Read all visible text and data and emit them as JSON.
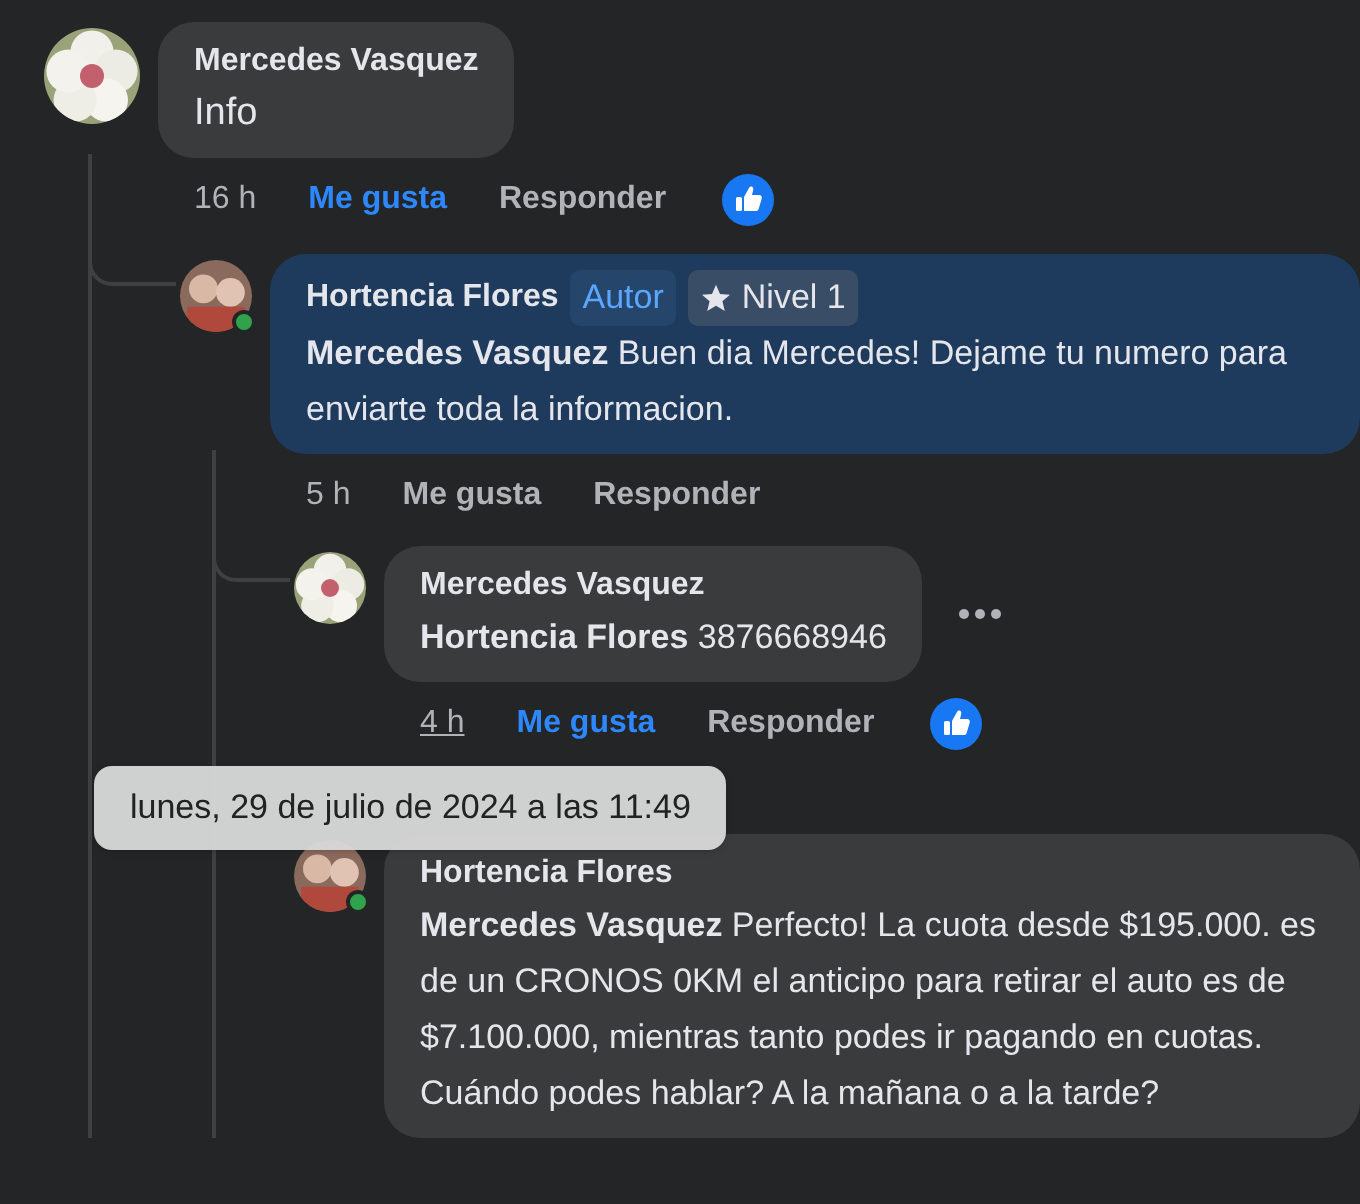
{
  "comments": [
    {
      "author": "Mercedes Vasquez",
      "text": "Info",
      "time": "16 h",
      "like_label": "Me gusta",
      "liked": true,
      "reply_label": "Responder",
      "reaction": true,
      "children": [
        {
          "author": "Hortencia Flores",
          "text": "**Mercedes Vasquez** Buen dia Mercedes! Dejame tu numero para enviarte toda la informacion.",
          "time": "5 h",
          "like_label": "Me gusta",
          "liked": false,
          "reply_label": "Responder",
          "online": true,
          "highlighted": true,
          "badges": [
            {
              "kind": "author",
              "label": "Autor"
            },
            {
              "kind": "level",
              "label": "Nivel 1"
            }
          ],
          "children": [
            {
              "author": "Mercedes Vasquez",
              "text": "**Hortencia Flores** 3876668946",
              "time": "4 h",
              "time_underlined": true,
              "like_label": "Me gusta",
              "liked": true,
              "reply_label": "Responder",
              "reaction": true,
              "more_menu": true
            },
            {
              "author": "Hortencia Flores",
              "text": "**Mercedes Vasquez** Perfecto! La cuota desde $195.000. es de un CRONOS 0KM el anticipo para retirar el auto es de $7.100.000, mientras tanto podes ir pagando en cuotas. Cuándo podes hablar? A la mañana o a la tarde?",
              "online": true
            }
          ]
        }
      ]
    }
  ],
  "tooltip": {
    "text": "lunes, 29 de julio de 2024 a las 11:49"
  }
}
